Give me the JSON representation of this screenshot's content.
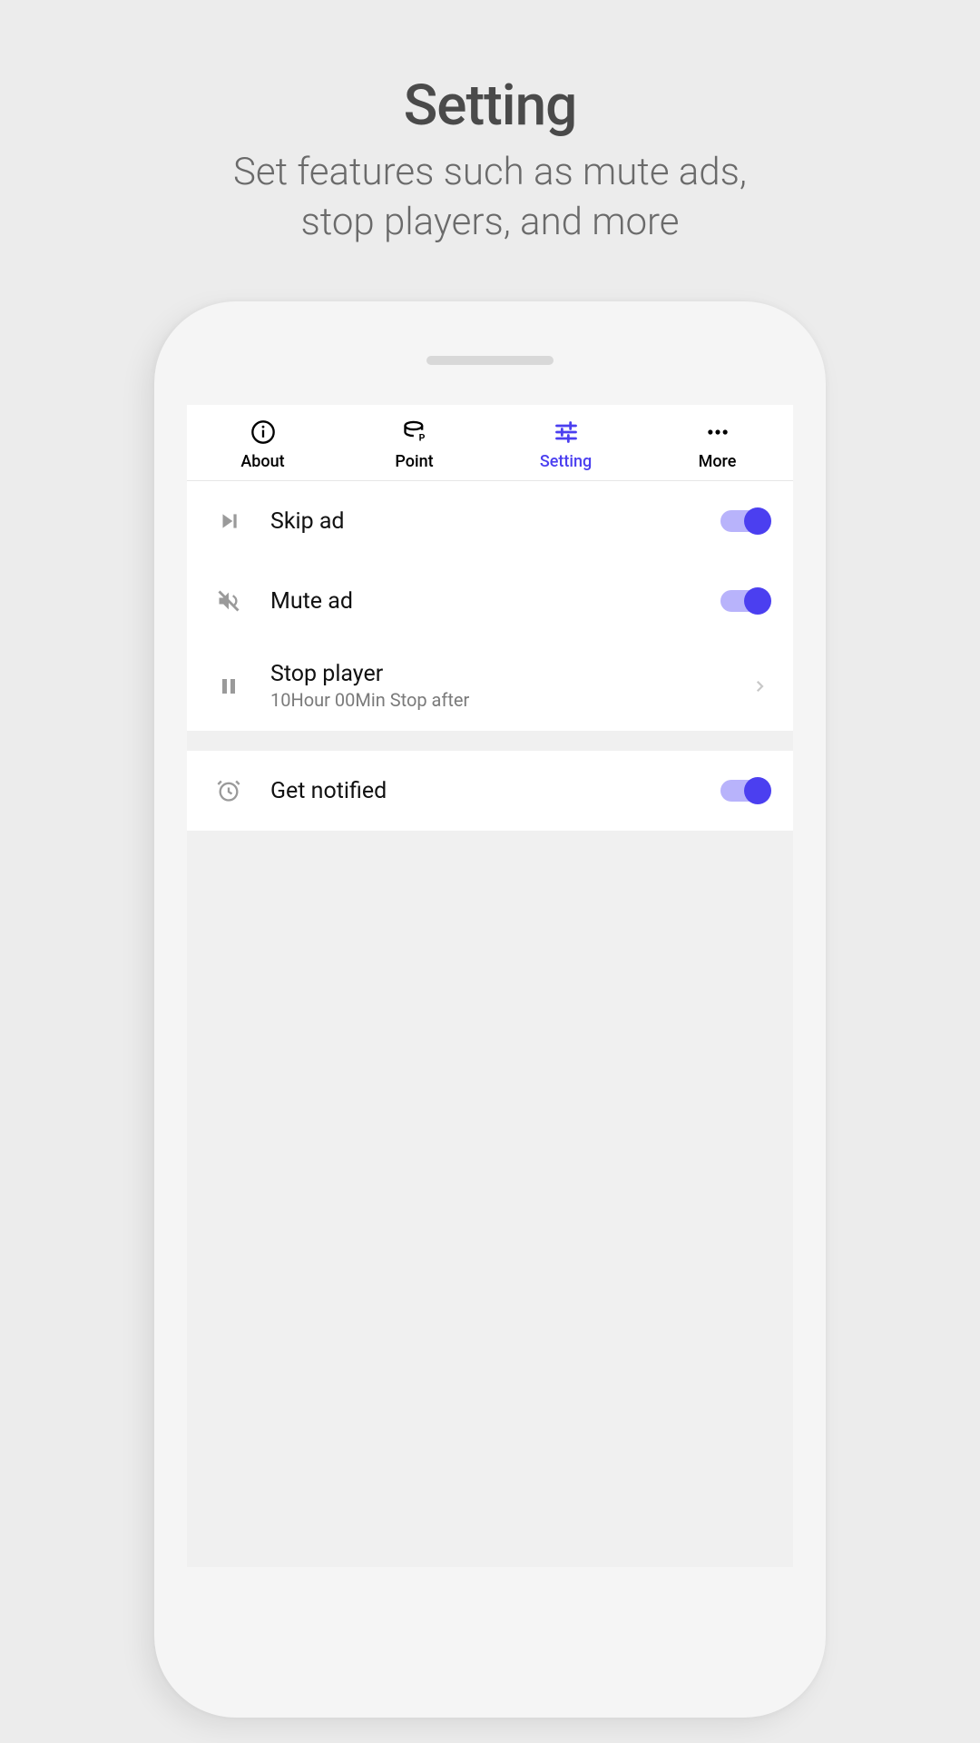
{
  "header": {
    "title": "Setting",
    "subtitle_line1": "Set features such as mute ads,",
    "subtitle_line2": "stop players, and more"
  },
  "tabs": {
    "about": "About",
    "point": "Point",
    "setting": "Setting",
    "more": "More",
    "active": "setting"
  },
  "settings": {
    "skip_ad": {
      "label": "Skip ad",
      "enabled": true
    },
    "mute_ad": {
      "label": "Mute ad",
      "enabled": true
    },
    "stop_player": {
      "label": "Stop player",
      "sub": "10Hour 00Min Stop after"
    },
    "get_notified": {
      "label": "Get notified",
      "enabled": true
    }
  },
  "colors": {
    "accent": "#4b3ff0",
    "accent_light": "#b8b3fb",
    "icon_grey": "#9a9a9a"
  }
}
